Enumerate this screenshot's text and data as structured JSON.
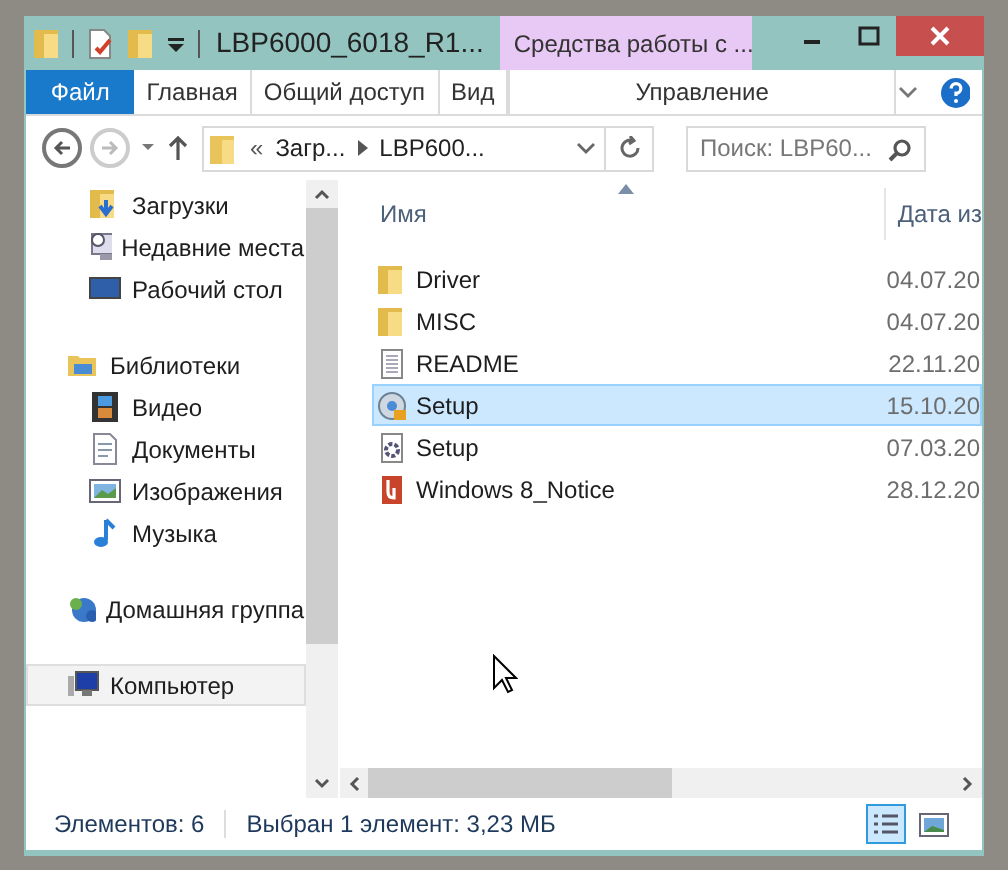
{
  "window": {
    "title": "LBP6000_6018_R1...",
    "context_tab": "Средства работы с ..."
  },
  "ribbon_tabs": [
    {
      "label": "Файл",
      "kind": "file",
      "selected": false
    },
    {
      "label": "Главная",
      "kind": "tab",
      "selected": false
    },
    {
      "label": "Общий доступ",
      "kind": "tab",
      "selected": false
    },
    {
      "label": "Вид",
      "kind": "tab",
      "selected": false
    },
    {
      "label": "Управление",
      "kind": "context",
      "selected": false
    }
  ],
  "address": {
    "prefix": "«",
    "crumbs": [
      "Загр...",
      "LBP600..."
    ]
  },
  "search": {
    "placeholder": "Поиск: LBP60..."
  },
  "navigation": [
    {
      "label": "Загрузки",
      "kind": "downloads",
      "selected": false
    },
    {
      "label": "Недавние места",
      "kind": "recent",
      "selected": false
    },
    {
      "label": "Рабочий стол",
      "kind": "desktop",
      "selected": false
    },
    {
      "label": "Библиотеки",
      "kind": "libraries",
      "selected": false
    },
    {
      "label": "Видео",
      "kind": "video",
      "selected": false
    },
    {
      "label": "Документы",
      "kind": "documents",
      "selected": false
    },
    {
      "label": "Изображения",
      "kind": "pictures",
      "selected": false
    },
    {
      "label": "Музыка",
      "kind": "music",
      "selected": false
    },
    {
      "label": "Домашняя группа",
      "kind": "homegroup",
      "selected": false
    },
    {
      "label": "Компьютер",
      "kind": "computer",
      "selected": true
    }
  ],
  "columns": [
    "Имя",
    "Дата из"
  ],
  "files": [
    {
      "name": "Driver",
      "date": "04.07.20",
      "kind": "folder",
      "selected": false
    },
    {
      "name": "MISC",
      "date": "04.07.20",
      "kind": "folder",
      "selected": false
    },
    {
      "name": "README",
      "date": "22.11.20",
      "kind": "text",
      "selected": false
    },
    {
      "name": "Setup",
      "date": "15.10.20",
      "kind": "setup",
      "selected": true
    },
    {
      "name": "Setup",
      "date": "07.03.20",
      "kind": "settings",
      "selected": false
    },
    {
      "name": "Windows 8_Notice",
      "date": "28.12.20",
      "kind": "pdf",
      "selected": false
    }
  ],
  "status_bar": {
    "count": "Элементов: 6",
    "selection": "Выбран 1 элемент: 3,23 МБ",
    "views": [
      {
        "kind": "details",
        "selected": true
      },
      {
        "kind": "thumbnails",
        "selected": false
      }
    ]
  }
}
